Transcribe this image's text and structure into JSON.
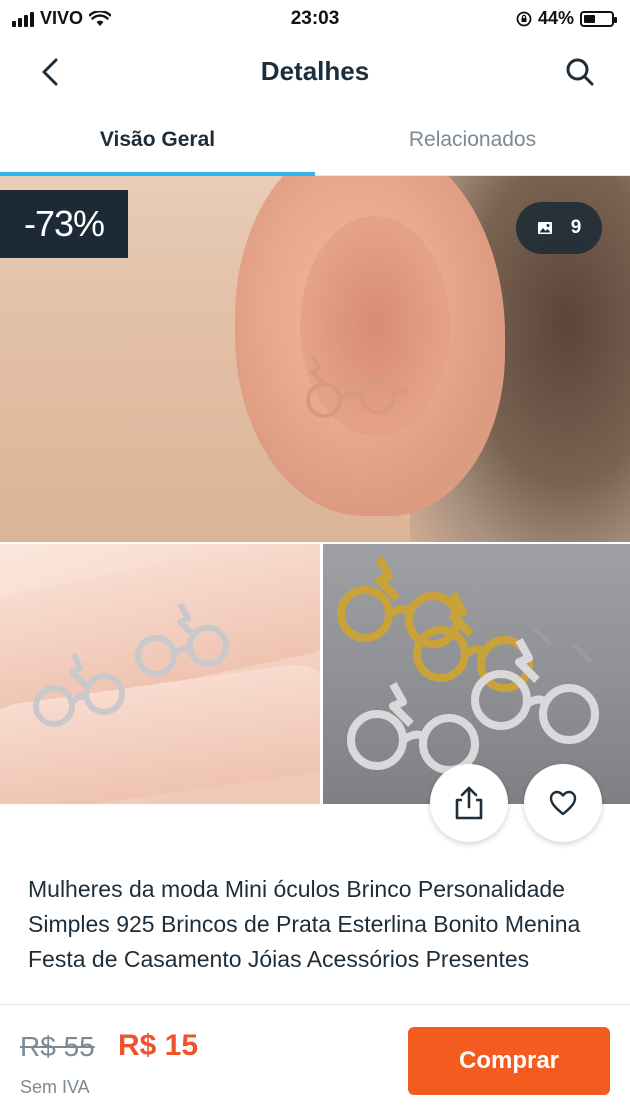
{
  "status_bar": {
    "carrier": "VIVO",
    "time": "23:03",
    "battery": "44%",
    "battery_level": 0.44
  },
  "header": {
    "title": "Detalhes",
    "back_icon": "chevron-left-icon",
    "search_icon": "search-icon"
  },
  "tabs": [
    {
      "label": "Visão Geral",
      "active": true
    },
    {
      "label": "Relacionados",
      "active": false
    }
  ],
  "gallery": {
    "discount_badge": "-73%",
    "image_count": "9",
    "image_icon": "image-icon"
  },
  "actions": {
    "share_icon": "share-icon",
    "like_icon": "heart-icon"
  },
  "product": {
    "title": "Mulheres da moda Mini óculos Brinco Personalidade Simples 925 Brincos de Prata Esterlina Bonito Menina Festa de Casamento Jóias Acessórios Presentes"
  },
  "purchase": {
    "old_price": "R$ 55",
    "new_price": "R$ 15",
    "tax_note": "Sem IVA",
    "buy_label": "Comprar"
  },
  "colors": {
    "accent_tab": "#2fb7ec",
    "price": "#f0522e",
    "buy_button": "#f45b1f",
    "badge_bg": "#1b2a36"
  }
}
